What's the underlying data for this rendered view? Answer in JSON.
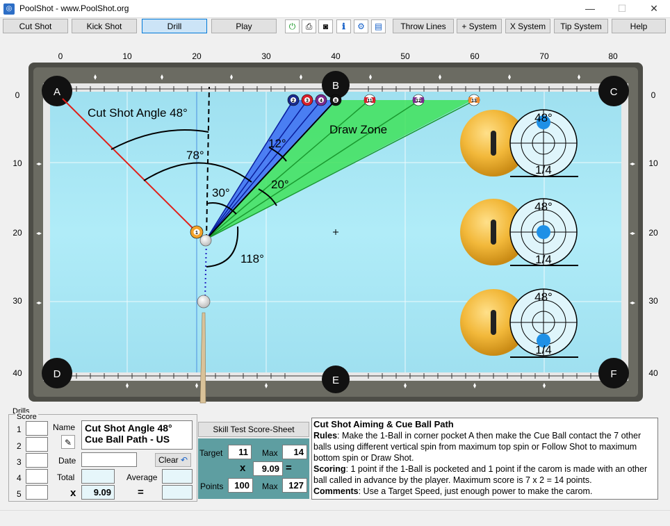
{
  "window": {
    "app_title": "PoolShot - www.PoolShot.org",
    "minimize": "—",
    "maximize": "☐",
    "close": "✕"
  },
  "toolbar": {
    "cut_shot": "Cut Shot",
    "kick_shot": "Kick Shot",
    "drill": "Drill",
    "play": "Play",
    "throw_lines": "Throw Lines",
    "plus_system": "+ System",
    "x_system": "X System",
    "tip_system": "Tip System",
    "help": "Help",
    "icons": [
      "power-icon",
      "print-icon",
      "camera-icon",
      "info-icon",
      "settings-icon",
      "notes-icon"
    ]
  },
  "table": {
    "top_ruler": [
      "0",
      "10",
      "20",
      "30",
      "40",
      "50",
      "60",
      "70",
      "80"
    ],
    "left_ruler": [
      "0",
      "10",
      "20",
      "30",
      "40"
    ],
    "right_ruler": [
      "0",
      "10",
      "20",
      "30",
      "40"
    ],
    "pockets": {
      "a": "A",
      "b": "B",
      "c": "C",
      "d": "D",
      "e": "E",
      "f": "F"
    },
    "ball_labels": {
      "one": "1",
      "two": "2",
      "three": "3",
      "four": "4",
      "eight": "8",
      "eleven": "11",
      "twelve": "12",
      "thirteen": "13"
    },
    "cut_shot_label": "Cut Shot Angle 48°",
    "draw_zone_label": "Draw Zone",
    "angle_12": "12°",
    "angle_78": "78°",
    "angle_30": "30°",
    "angle_20": "20°",
    "angle_118": "118°",
    "aim_panels": [
      {
        "angle": "48°",
        "fraction": "1/4"
      },
      {
        "angle": "48°",
        "fraction": "1/4"
      },
      {
        "angle": "48°",
        "fraction": "1/4"
      }
    ],
    "colors": {
      "felt": "#a9e7f4",
      "rail": "#5a5a52",
      "cut_line": "#e0201a",
      "blue_zone": "#3b6cf2",
      "green_zone": "#3fe25a"
    }
  },
  "drills": {
    "group_label": "Drills",
    "score_label": "Score",
    "rows": [
      "1",
      "2",
      "3",
      "4",
      "5"
    ],
    "name_label": "Name",
    "name_value": "Cut Shot Angle 48°\nCue Ball Path - US",
    "date_label": "Date",
    "clear_label": "Clear",
    "total_label": "Total",
    "average_label": "Average",
    "x_symbol": "x",
    "multiplier": "9.09",
    "equals": "="
  },
  "skill": {
    "button": "Skill Test Score-Sheet",
    "target_label": "Target",
    "target_value": "11",
    "max_label": "Max",
    "max_value": "14",
    "x_symbol": "x",
    "factor": "9.09",
    "equals": "=",
    "points_label": "Points",
    "points_value": "100",
    "max2_label": "Max",
    "max2_value": "127"
  },
  "description": {
    "title": "Cut Shot Aiming & Cue Ball Path",
    "rules_label": "Rules",
    "rules_text": ": Make the 1-Ball in corner pocket A then make the Cue Ball contact the 7 other balls using different vertical spin from maximum top spin or Follow Shot to maximum bottom spin or Draw Shot.",
    "scoring_label": "Scoring",
    "scoring_text": ": 1 point if the 1-Ball is pocketed and 1 point if the carom is made with an other ball called in advance by the player. Maximum score is 7 x 2 = 14 points.",
    "comments_label": "Comments",
    "comments_text": ": Use a Target Speed, just enough power to make the carom."
  }
}
